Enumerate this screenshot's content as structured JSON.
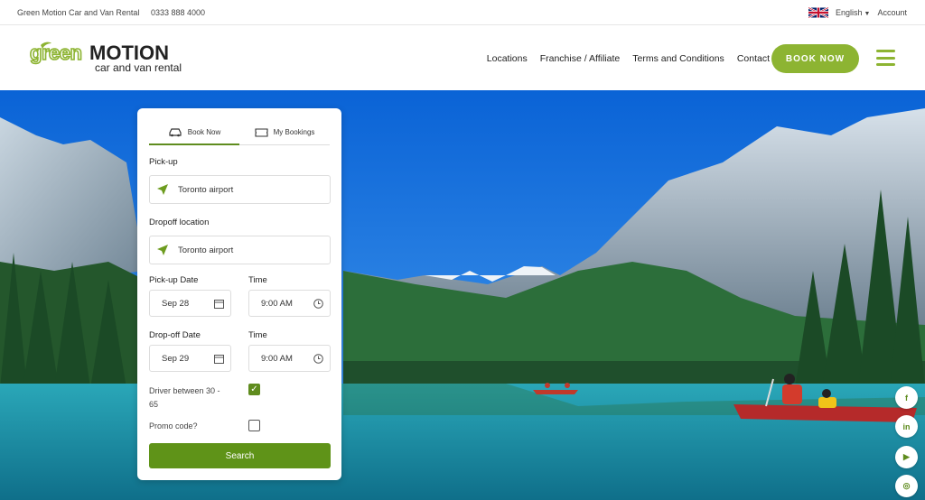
{
  "topbar": {
    "company": "Green Motion Car and Van Rental",
    "phone": "0333 888 4000",
    "language": "English",
    "account": "Account"
  },
  "header": {
    "logo_top": "greenMOTION",
    "logo_sub": "car and van rental",
    "nav": [
      "Locations",
      "Franchise / Affiliate",
      "Terms and Conditions",
      "Contact"
    ],
    "book_now": "BOOK NOW"
  },
  "booking": {
    "tabs": {
      "book": "Book Now",
      "bookings": "My Bookings"
    },
    "pickup_label": "Pick-up",
    "pickup_value": "Toronto airport",
    "dropoff_label": "Dropoff location",
    "dropoff_value": "Toronto airport",
    "pickup_date_label": "Pick-up Date",
    "pickup_date": "Sep 28",
    "time_label": "Time",
    "pickup_time": "9:00 AM",
    "dropoff_date_label": "Drop-off Date",
    "dropoff_date": "Sep 29",
    "dropoff_time": "9:00 AM",
    "driver_label_1": "Driver between 30 -",
    "driver_label_2": "65",
    "promo_label": "Promo code?",
    "search": "Search"
  },
  "social": [
    "f",
    "in",
    "▶",
    "◎"
  ],
  "colors": {
    "brand_green": "#8db432",
    "dark_green": "#5f8c1e"
  }
}
